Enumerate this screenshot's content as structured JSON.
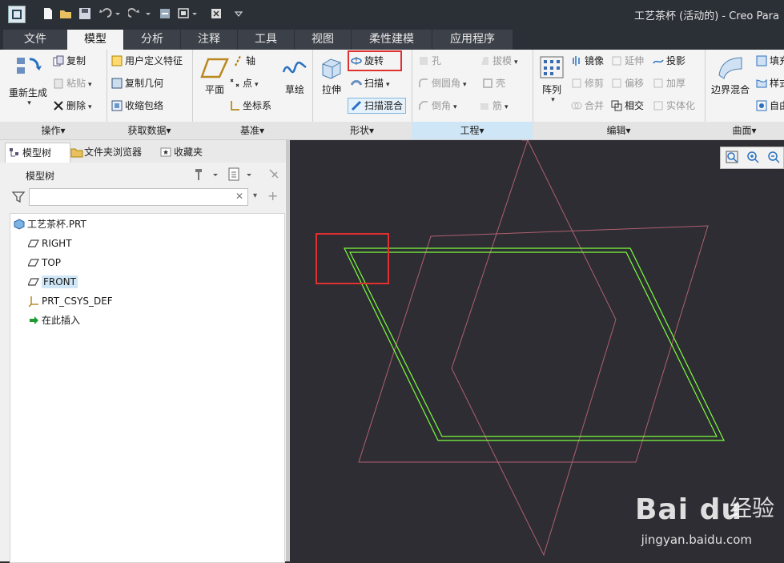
{
  "window": {
    "title": "工艺茶杯 (活动的) - Creo Para"
  },
  "menu_tabs": [
    {
      "label": "文件"
    },
    {
      "label": "模型"
    },
    {
      "label": "分析"
    },
    {
      "label": "注释"
    },
    {
      "label": "工具"
    },
    {
      "label": "视图"
    },
    {
      "label": "柔性建模"
    },
    {
      "label": "应用程序"
    }
  ],
  "ribbon": {
    "operations": {
      "label": "操作▾",
      "regenerate": "重新生成",
      "copy": "复制",
      "paste": "粘贴",
      "delete": "删除"
    },
    "get_data": {
      "label": "获取数据▾",
      "udf": "用户定义特征",
      "copy_geom": "复制几何",
      "shrinkwrap": "收缩包络"
    },
    "datum": {
      "label": "基准▾",
      "plane": "平面",
      "axis": "轴",
      "point": "点",
      "csys": "坐标系",
      "sketch": "草绘"
    },
    "shapes": {
      "label": "形状▾",
      "extrude": "拉伸",
      "revolve": "旋转",
      "sweep": "扫描",
      "swept_blend": "扫描混合"
    },
    "engineering": {
      "label": "工程▾",
      "hole": "孔",
      "draft": "拔模",
      "round": "倒圆角",
      "shell": "壳",
      "chamfer": "倒角",
      "rib": "筋"
    },
    "editing": {
      "label": "编辑▾",
      "pattern": "阵列",
      "mirror": "镜像",
      "extend": "延伸",
      "project": "投影",
      "trim": "修剪",
      "offset": "偏移",
      "thicken": "加厚",
      "merge": "合并",
      "intersect": "相交",
      "solidify": "实体化"
    },
    "surfaces": {
      "label": "曲面▾",
      "boundary_blend": "边界混合",
      "fill": "填充",
      "style": "样式",
      "freestyle": "自由"
    }
  },
  "panel": {
    "tabs": [
      {
        "label": "模型树"
      },
      {
        "label": "文件夹浏览器"
      },
      {
        "label": "收藏夹"
      }
    ],
    "header": "模型树",
    "search": {
      "value": "",
      "placeholder": ""
    },
    "tree": [
      {
        "label": "工艺茶杯.PRT"
      },
      {
        "label": "RIGHT"
      },
      {
        "label": "TOP"
      },
      {
        "label": "FRONT"
      },
      {
        "label": "PRT_CSYS_DEF"
      },
      {
        "label": "在此插入"
      }
    ]
  },
  "watermark": {
    "logo": "Bai du",
    "cn": "经验",
    "url": "jingyan.baidu.com"
  },
  "colors": {
    "accent": "#cfe6f7",
    "sketch": "#7cff3c",
    "datum": "#b06070",
    "highlight": "#e03030"
  }
}
